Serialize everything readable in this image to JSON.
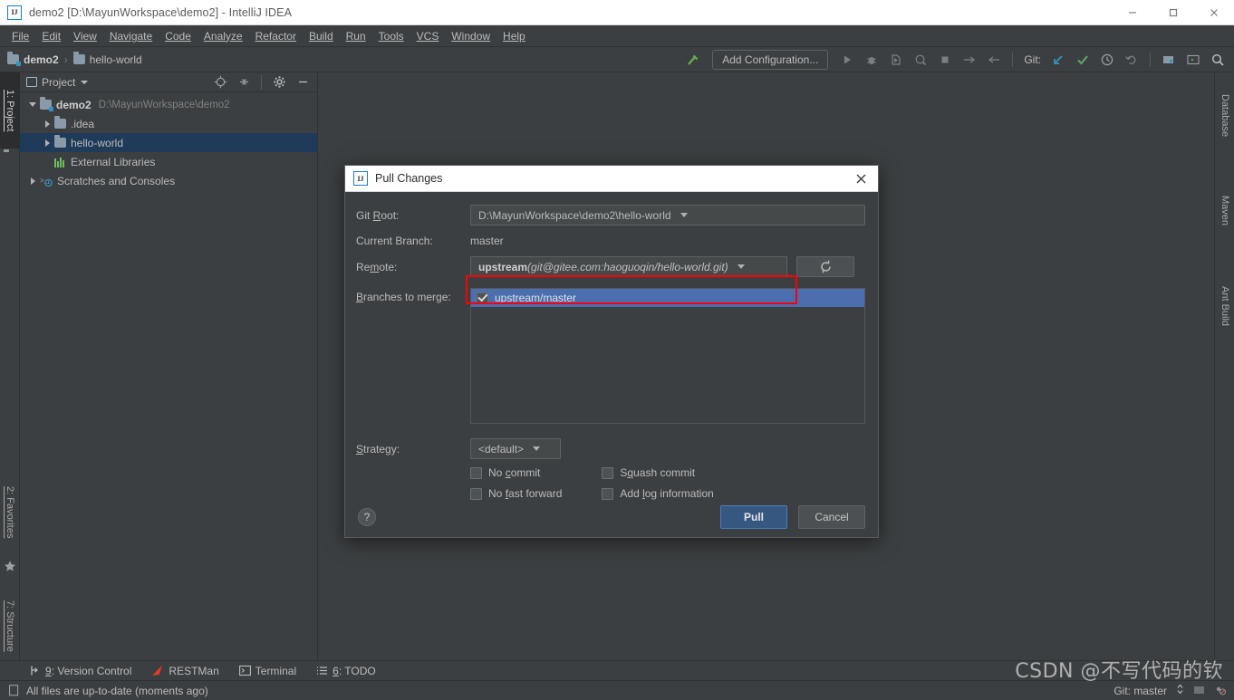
{
  "window": {
    "title": "demo2 [D:\\MayunWorkspace\\demo2] - IntelliJ IDEA",
    "app_icon": "IJ",
    "minimize_label": "minimize",
    "maximize_label": "maximize",
    "close_label": "close"
  },
  "menubar": {
    "items": [
      {
        "label": "File"
      },
      {
        "label": "Edit"
      },
      {
        "label": "View"
      },
      {
        "label": "Navigate"
      },
      {
        "label": "Code"
      },
      {
        "label": "Analyze"
      },
      {
        "label": "Refactor"
      },
      {
        "label": "Build"
      },
      {
        "label": "Run"
      },
      {
        "label": "Tools"
      },
      {
        "label": "VCS"
      },
      {
        "label": "Window"
      },
      {
        "label": "Help"
      }
    ]
  },
  "navbar": {
    "crumbs": [
      {
        "label": "demo2"
      },
      {
        "label": "hello-world"
      }
    ],
    "separator": "›",
    "add_configuration": "Add Configuration...",
    "git_label": "Git:"
  },
  "left_strip": {
    "project_tab": "1: Project",
    "favorites_tab": "2: Favorites",
    "structure_tab": "7: Structure"
  },
  "right_strip": {
    "database_tab": "Database",
    "maven_tab": "Maven",
    "ant_build_tab": "Ant Build"
  },
  "project_panel": {
    "title": "Project",
    "tree": [
      {
        "label": "demo2",
        "path": "D:\\MayunWorkspace\\demo2",
        "indent": 0,
        "state": "expanded",
        "icon": "module-folder",
        "bold": true,
        "selected": false
      },
      {
        "label": ".idea",
        "path": "",
        "indent": 1,
        "state": "collapsed",
        "icon": "folder",
        "bold": false,
        "selected": false
      },
      {
        "label": "hello-world",
        "path": "",
        "indent": 1,
        "state": "collapsed",
        "icon": "folder",
        "bold": false,
        "selected": true
      },
      {
        "label": "External Libraries",
        "path": "",
        "indent": 1,
        "state": "leaf",
        "icon": "library",
        "bold": false,
        "selected": false
      },
      {
        "label": "Scratches and Consoles",
        "path": "",
        "indent": 0,
        "state": "collapsed",
        "icon": "scratch",
        "bold": false,
        "selected": false
      }
    ]
  },
  "dialog": {
    "title": "Pull Changes",
    "git_root_label": "Git Root:",
    "git_root_value": "D:\\MayunWorkspace\\demo2\\hello-world",
    "current_branch_label": "Current Branch:",
    "current_branch_value": "master",
    "remote_label": "Remote:",
    "remote_name": "upstream",
    "remote_url": "(git@gitee.com:haoguoqin/hello-world.git)",
    "refresh_icon": "refresh-icon",
    "branches_label": "Branches to merge:",
    "branches": [
      {
        "label": "upstream/master",
        "checked": true,
        "selected": true
      }
    ],
    "strategy_label": "Strategy:",
    "strategy_value": "<default>",
    "checkboxes": [
      {
        "label": "No commit",
        "checked": false
      },
      {
        "label": "Squash commit",
        "checked": false
      },
      {
        "label": "No fast forward",
        "checked": false
      },
      {
        "label": "Add log information",
        "checked": false
      }
    ],
    "help_label": "?",
    "pull_label": "Pull",
    "cancel_label": "Cancel",
    "highlight_color": "#fb0007",
    "primary_color": "#365880"
  },
  "bottom_tabs": [
    {
      "label": "9: Version Control",
      "icon": "branch-icon"
    },
    {
      "label": "RESTMan",
      "icon": "restman-icon"
    },
    {
      "label": "Terminal",
      "icon": "terminal-icon"
    },
    {
      "label": "6: TODO",
      "icon": "todo-icon"
    }
  ],
  "statusbar": {
    "message": "All files are up-to-date (moments ago)",
    "git_branch": "Git: master"
  },
  "watermark": {
    "text": "CSDN @不写代码的钦"
  }
}
